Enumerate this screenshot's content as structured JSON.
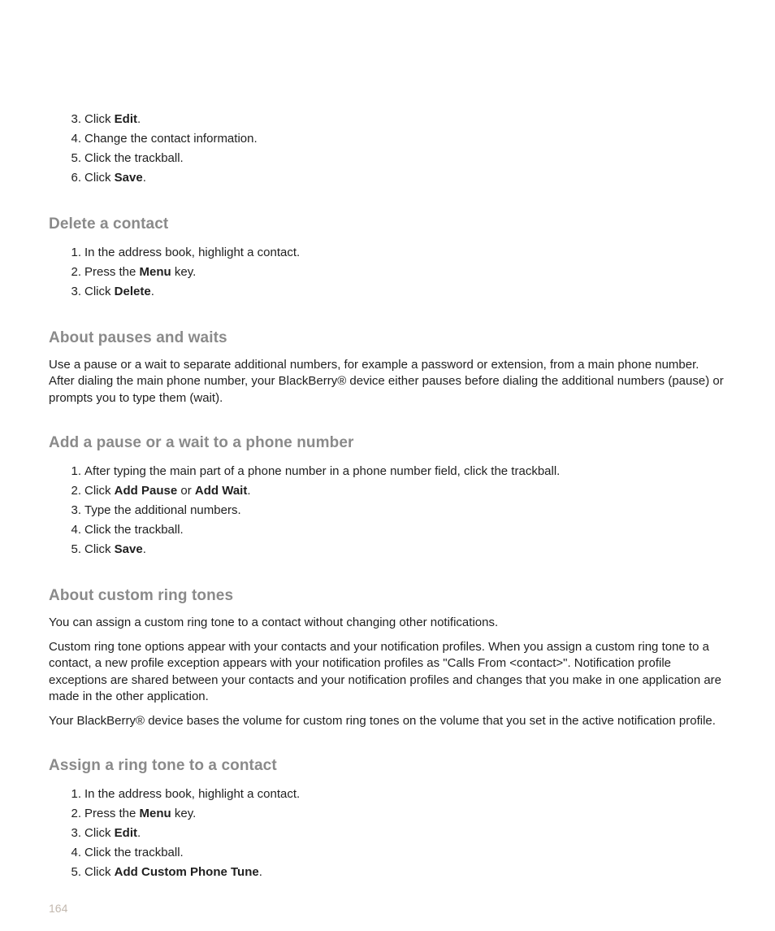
{
  "topList": {
    "start": 3,
    "items": [
      {
        "pre": "Click ",
        "bold": "Edit",
        "post": "."
      },
      {
        "pre": "Change the contact information.",
        "bold": "",
        "post": ""
      },
      {
        "pre": "Click the trackball.",
        "bold": "",
        "post": ""
      },
      {
        "pre": "Click ",
        "bold": "Save",
        "post": "."
      }
    ]
  },
  "sections": [
    {
      "heading": "Delete a contact",
      "list": [
        {
          "pre": "In the address book, highlight a contact.",
          "bold": "",
          "post": ""
        },
        {
          "pre": "Press the ",
          "bold": "Menu",
          "post": " key."
        },
        {
          "pre": "Click ",
          "bold": "Delete",
          "post": "."
        }
      ]
    },
    {
      "heading": "About pauses and waits",
      "paragraphs": [
        "Use a pause or a wait to separate additional numbers, for example a password or extension, from a main phone number. After dialing the main phone number, your BlackBerry® device either pauses before dialing the additional numbers (pause) or prompts you to type them (wait)."
      ]
    },
    {
      "heading": "Add a pause or a wait to a phone number",
      "list": [
        {
          "pre": "After typing the main part of a phone number in a phone number field, click the trackball.",
          "bold": "",
          "post": ""
        },
        {
          "pre": "Click ",
          "bold": "Add Pause",
          "mid": " or ",
          "bold2": "Add Wait",
          "post": "."
        },
        {
          "pre": "Type the additional numbers.",
          "bold": "",
          "post": ""
        },
        {
          "pre": "Click the trackball.",
          "bold": "",
          "post": ""
        },
        {
          "pre": "Click ",
          "bold": "Save",
          "post": "."
        }
      ]
    },
    {
      "heading": "About custom ring tones",
      "paragraphs": [
        "You can assign a custom ring tone to a contact without changing other notifications.",
        "Custom ring tone options appear with your contacts and your notification profiles. When you assign a custom ring tone to a contact, a new profile exception appears with your notification profiles as \"Calls From <contact>\". Notification profile exceptions are shared between your contacts and your notification profiles and changes that you make in one application are made in the other application.",
        "Your BlackBerry® device bases the volume for custom ring tones on the volume that you set in the active notification profile."
      ]
    },
    {
      "heading": "Assign a ring tone to a contact",
      "list": [
        {
          "pre": "In the address book, highlight a contact.",
          "bold": "",
          "post": ""
        },
        {
          "pre": "Press the ",
          "bold": "Menu",
          "post": " key."
        },
        {
          "pre": "Click ",
          "bold": "Edit",
          "post": "."
        },
        {
          "pre": "Click the trackball.",
          "bold": "",
          "post": ""
        },
        {
          "pre": "Click ",
          "bold": "Add Custom Phone Tune",
          "post": "."
        }
      ]
    }
  ],
  "pageNumber": "164"
}
